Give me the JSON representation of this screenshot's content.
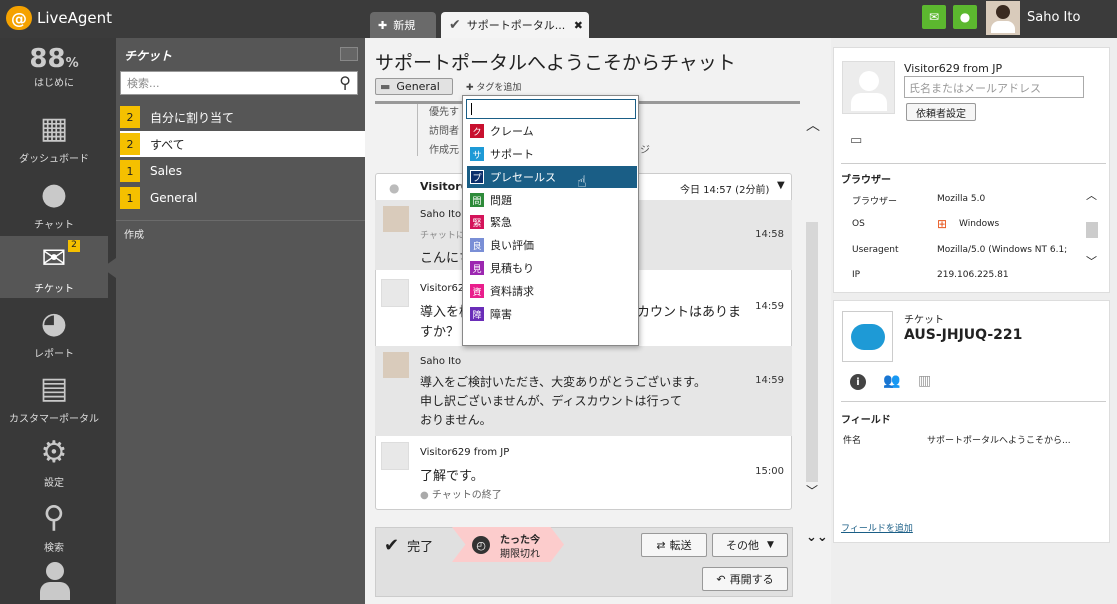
{
  "brand": "LiveAgent",
  "tabs": [
    {
      "label": "新規"
    },
    {
      "label": "サポートポータル..."
    }
  ],
  "user": {
    "name": "Saho Ito"
  },
  "nav": [
    {
      "label": "はじめに",
      "value": "88",
      "unit": "%"
    },
    {
      "label": "ダッシュボード"
    },
    {
      "label": "チャット"
    },
    {
      "label": "チケット",
      "badge": "2"
    },
    {
      "label": "レポート"
    },
    {
      "label": "カスタマーポータル"
    },
    {
      "label": "設定"
    },
    {
      "label": "検索"
    }
  ],
  "panel": {
    "title": "チケット",
    "search_placeholder": "検索...",
    "folders": [
      {
        "count": "2",
        "label": "自分に割り当て"
      },
      {
        "count": "2",
        "label": "すべて"
      },
      {
        "count": "1",
        "label": "Sales"
      },
      {
        "count": "1",
        "label": "General"
      }
    ],
    "create_label": "作成"
  },
  "ticket": {
    "title": "サポートポータルへようこそからチャット",
    "department": "General",
    "add_tag": "タグを追加",
    "meta_rows": [
      "優先す",
      "訪問者",
      "作成元"
    ],
    "meta_suffix": "ジ",
    "chat_header": {
      "sender": "Visitor62",
      "time": "今日 14:57 (2分前)"
    },
    "messages": [
      {
        "sender": "Saho Ito",
        "sub": "チャットに",
        "text": "こんにち",
        "time": "14:58"
      },
      {
        "sender": "Visitor62",
        "text": "導入を検",
        "text_right": "カウントはありま",
        "text2": "すか？",
        "time": "14:59"
      },
      {
        "sender": "Saho Ito",
        "text": "導入をご検討いただき、大変ありがとうございます。",
        "text2": "申し訳ございませんが、ディスカウントは行って",
        "text3": "おりません。",
        "time": "14:59"
      },
      {
        "sender": "Visitor629 from JP",
        "text": "了解です。",
        "time": "15:00",
        "footer": "チャットの終了"
      }
    ]
  },
  "tags": [
    {
      "abbr": "ク",
      "label": "クレーム",
      "color": "#c8102e"
    },
    {
      "abbr": "サ",
      "label": "サポート",
      "color": "#1e9ad6"
    },
    {
      "abbr": "プ",
      "label": "プレセールス",
      "color": "#0d2f6b"
    },
    {
      "abbr": "問",
      "label": "問題",
      "color": "#2e8b3a"
    },
    {
      "abbr": "緊",
      "label": "緊急",
      "color": "#d4145a"
    },
    {
      "abbr": "良",
      "label": "良い評価",
      "color": "#7a8fd6"
    },
    {
      "abbr": "見",
      "label": "見積もり",
      "color": "#9c27b0"
    },
    {
      "abbr": "資",
      "label": "資料請求",
      "color": "#e91e8c"
    },
    {
      "abbr": "障",
      "label": "障害",
      "color": "#6a2db8"
    }
  ],
  "actions": {
    "done": "完了",
    "deadline_1": "たった今",
    "deadline_2": "期限切れ",
    "transfer": "転送",
    "other": "その他",
    "reopen": "再開する"
  },
  "visitor": {
    "name": "Visitor629 from JP",
    "input_placeholder": "氏名またはメールアドレス",
    "set_requester": "依頼者設定",
    "browser_heading": "ブラウザー",
    "props": [
      {
        "k": "ブラウザー",
        "v": "Mozilla 5.0"
      },
      {
        "k": "OS",
        "v": "Windows"
      },
      {
        "k": "Useragent",
        "v": "Mozilla/5.0 (Windows NT 6.1;"
      },
      {
        "k": "IP",
        "v": "219.106.225.81"
      }
    ]
  },
  "ticket_info": {
    "label": "チケット",
    "code": "AUS-JHJUQ-221",
    "fields_heading": "フィールド",
    "field": {
      "k": "件名",
      "v": "サポートポータルへようこそから..."
    },
    "add_field": "フィールドを追加"
  }
}
